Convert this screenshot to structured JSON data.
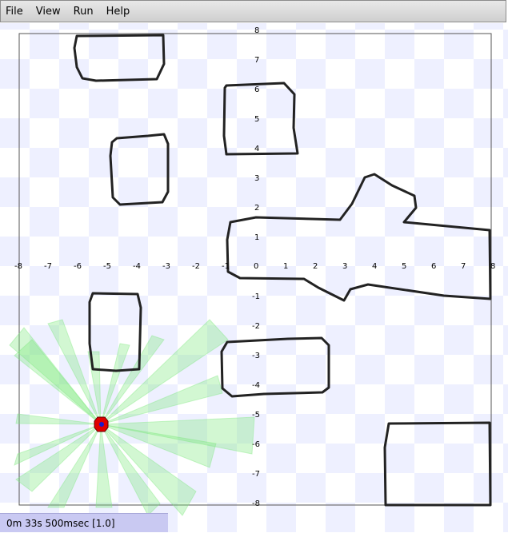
{
  "menu": {
    "file": "File",
    "view": "View",
    "run": "Run",
    "help": "Help"
  },
  "status": {
    "time": "0m 33s 500msec [1.0]"
  },
  "world": {
    "x_ticks": [
      "-8",
      "-7",
      "-6",
      "-5",
      "-4",
      "-3",
      "-2",
      "-1",
      "0",
      "1",
      "2",
      "3",
      "4",
      "5",
      "6",
      "7",
      "8"
    ],
    "y_ticks": [
      "8",
      "7",
      "6",
      "5",
      "4",
      "3",
      "2",
      "1",
      "-1",
      "-2",
      "-3",
      "-4",
      "-5",
      "-6",
      "-7",
      "-8"
    ],
    "colors": {
      "checker": "#eef0ff",
      "obstacle": "#222222",
      "laser": "#7fe87f",
      "robot_body": "#e00000",
      "robot_center": "#1a1acc"
    }
  }
}
